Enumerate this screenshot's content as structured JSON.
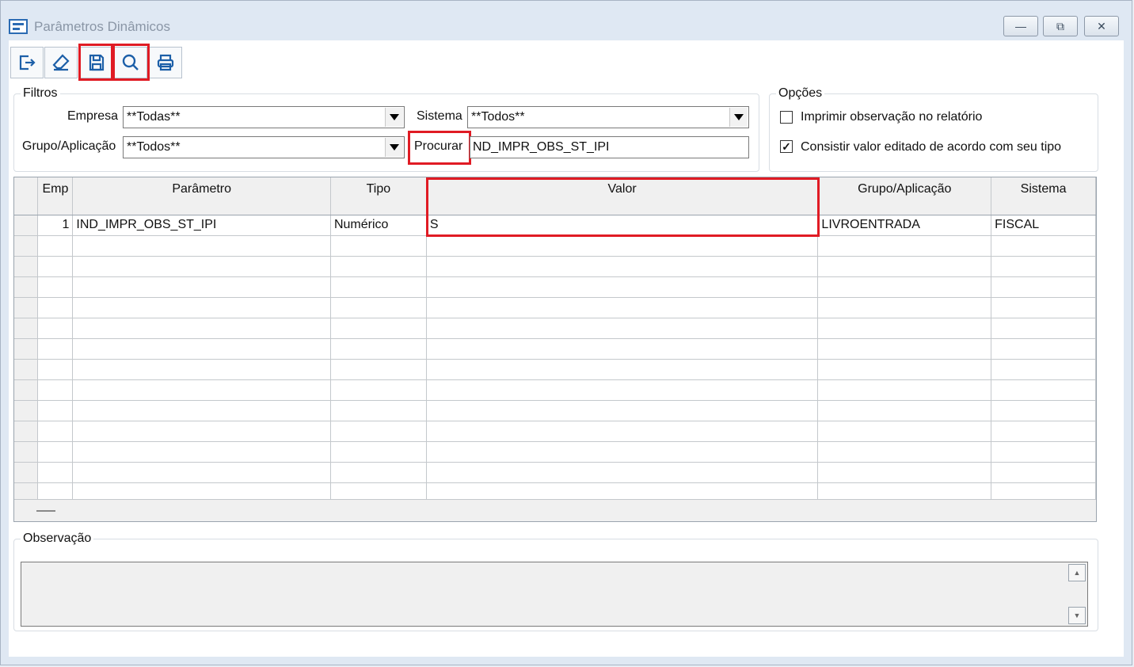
{
  "window": {
    "title": "Parâmetros Dinâmicos"
  },
  "window_controls": {
    "minimize": "—",
    "restore": "⧉",
    "close": "✕"
  },
  "toolbar": {
    "buttons": [
      {
        "name": "exit-button",
        "icon": "exit-icon"
      },
      {
        "name": "clear-button",
        "icon": "eraser-icon"
      },
      {
        "name": "save-button",
        "icon": "floppy-disk-icon"
      },
      {
        "name": "search-button",
        "icon": "magnifier-icon"
      },
      {
        "name": "print-button",
        "icon": "printer-icon"
      }
    ]
  },
  "filters": {
    "legend": "Filtros",
    "empresa_label": "Empresa",
    "empresa_value": "**Todas**",
    "sistema_label": "Sistema",
    "sistema_value": "**Todos**",
    "grupo_label": "Grupo/Aplicação",
    "grupo_value": "**Todos**",
    "procurar_label": "Procurar",
    "procurar_value": "ND_IMPR_OBS_ST_IPI"
  },
  "options": {
    "legend": "Opções",
    "opt1_label": "Imprimir observação no relatório",
    "opt1_checked": false,
    "opt2_label": "Consistir valor editado de acordo com seu tipo",
    "opt2_checked": true
  },
  "grid": {
    "headers": {
      "emp": "Emp",
      "parametro": "Parâmetro",
      "tipo": "Tipo",
      "valor": "Valor",
      "grupo": "Grupo/Aplicação",
      "sistema": "Sistema"
    },
    "rows": [
      {
        "emp": "1",
        "parametro": "IND_IMPR_OBS_ST_IPI",
        "tipo": "Numérico",
        "valor": "S",
        "grupo": "LIVROENTRADA",
        "sistema": "FISCAL"
      }
    ]
  },
  "observacao": {
    "legend": "Observação"
  },
  "colors": {
    "highlight": "#e01b24",
    "icon": "#1c5fa8"
  }
}
